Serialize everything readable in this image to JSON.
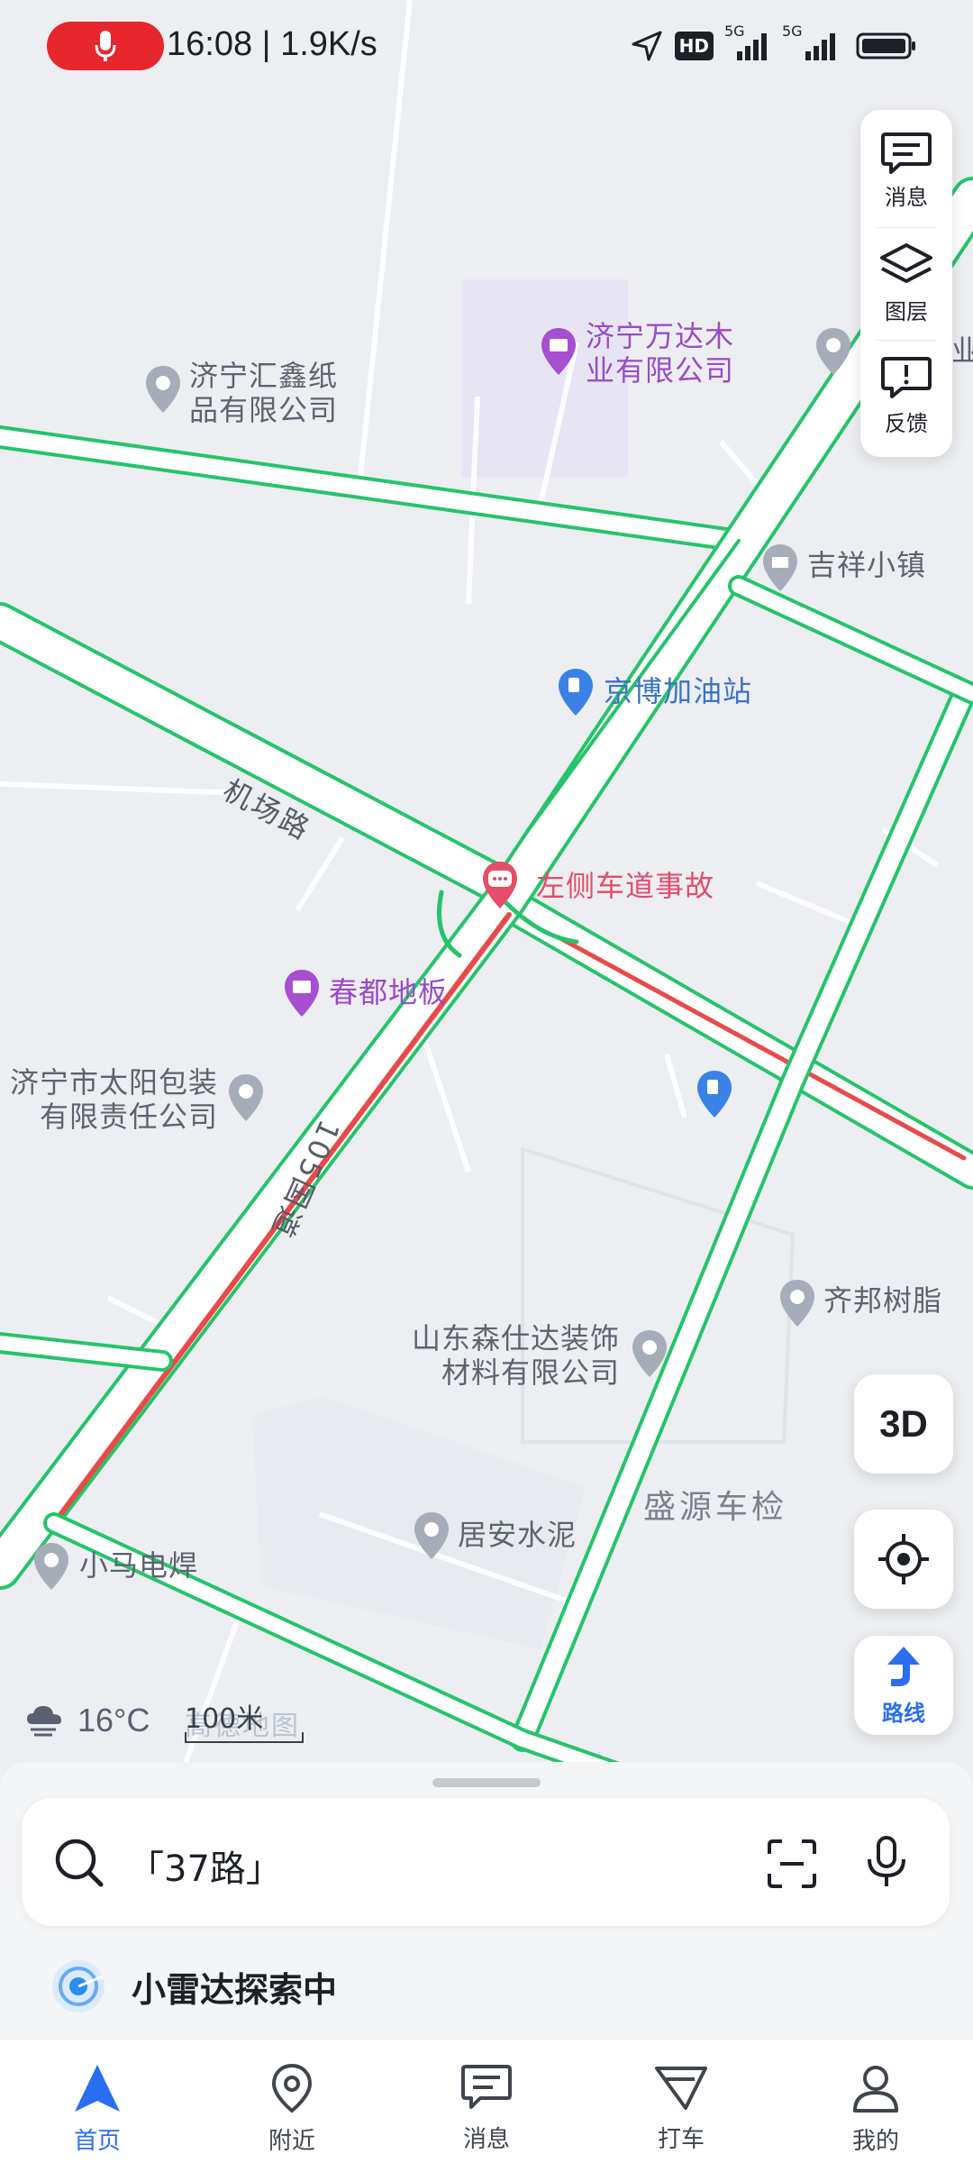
{
  "status_bar": {
    "time_speed": "16:08 | 1.9K/s",
    "hd_badge": "HD",
    "net1": "5G",
    "net2": "5G",
    "icons": [
      "mic-icon",
      "location-arrow-icon",
      "signal-icon",
      "battery-icon"
    ]
  },
  "map": {
    "pois": [
      {
        "id": "jining-huixin",
        "label": "济宁汇鑫纸\n品有限公司",
        "type": "grey"
      },
      {
        "id": "jining-wanda",
        "label": "济宁万达木\n业有限公司",
        "type": "purple"
      },
      {
        "id": "jixiang",
        "label": "吉祥小镇",
        "type": "grey"
      },
      {
        "id": "jingbo",
        "label": "京博加油站",
        "type": "blue"
      },
      {
        "id": "accident",
        "label": "左侧车道事故",
        "type": "red"
      },
      {
        "id": "chundu",
        "label": "春都地板",
        "type": "purple"
      },
      {
        "id": "taiyang",
        "label": "济宁市太阳包装\n有限责任公司",
        "type": "grey"
      },
      {
        "id": "qibang",
        "label": "齐邦树脂",
        "type": "grey"
      },
      {
        "id": "sensida",
        "label": "山东森仕达装饰\n材料有限公司",
        "type": "grey"
      },
      {
        "id": "shengyuan",
        "label": "盛源车检",
        "type": "dark"
      },
      {
        "id": "juan",
        "label": "居安水泥",
        "type": "grey"
      },
      {
        "id": "xiaoma",
        "label": "小马电焊",
        "type": "grey"
      },
      {
        "id": "edge",
        "label": "业",
        "type": "grey"
      }
    ],
    "road_names": {
      "airport_road": "机场路",
      "national_road": "105国道"
    },
    "accent_colors": {
      "road_edge": "#25c46a",
      "congestion": "#e84a4a",
      "brand": "#2a6ef0"
    }
  },
  "right_panel": {
    "message": "消息",
    "layers": "图层",
    "feedback": "反馈"
  },
  "buttons": {
    "three_d": "3D",
    "route": "路线"
  },
  "weather": {
    "temp": "16°C"
  },
  "scale": {
    "label": "100米"
  },
  "watermark": "高德地图",
  "search": {
    "text": "「37路」"
  },
  "radar": {
    "text": "小雷达探索中"
  },
  "nav": [
    {
      "label": "首页",
      "active": true
    },
    {
      "label": "附近",
      "active": false
    },
    {
      "label": "消息",
      "active": false
    },
    {
      "label": "打车",
      "active": false
    },
    {
      "label": "我的",
      "active": false
    }
  ]
}
